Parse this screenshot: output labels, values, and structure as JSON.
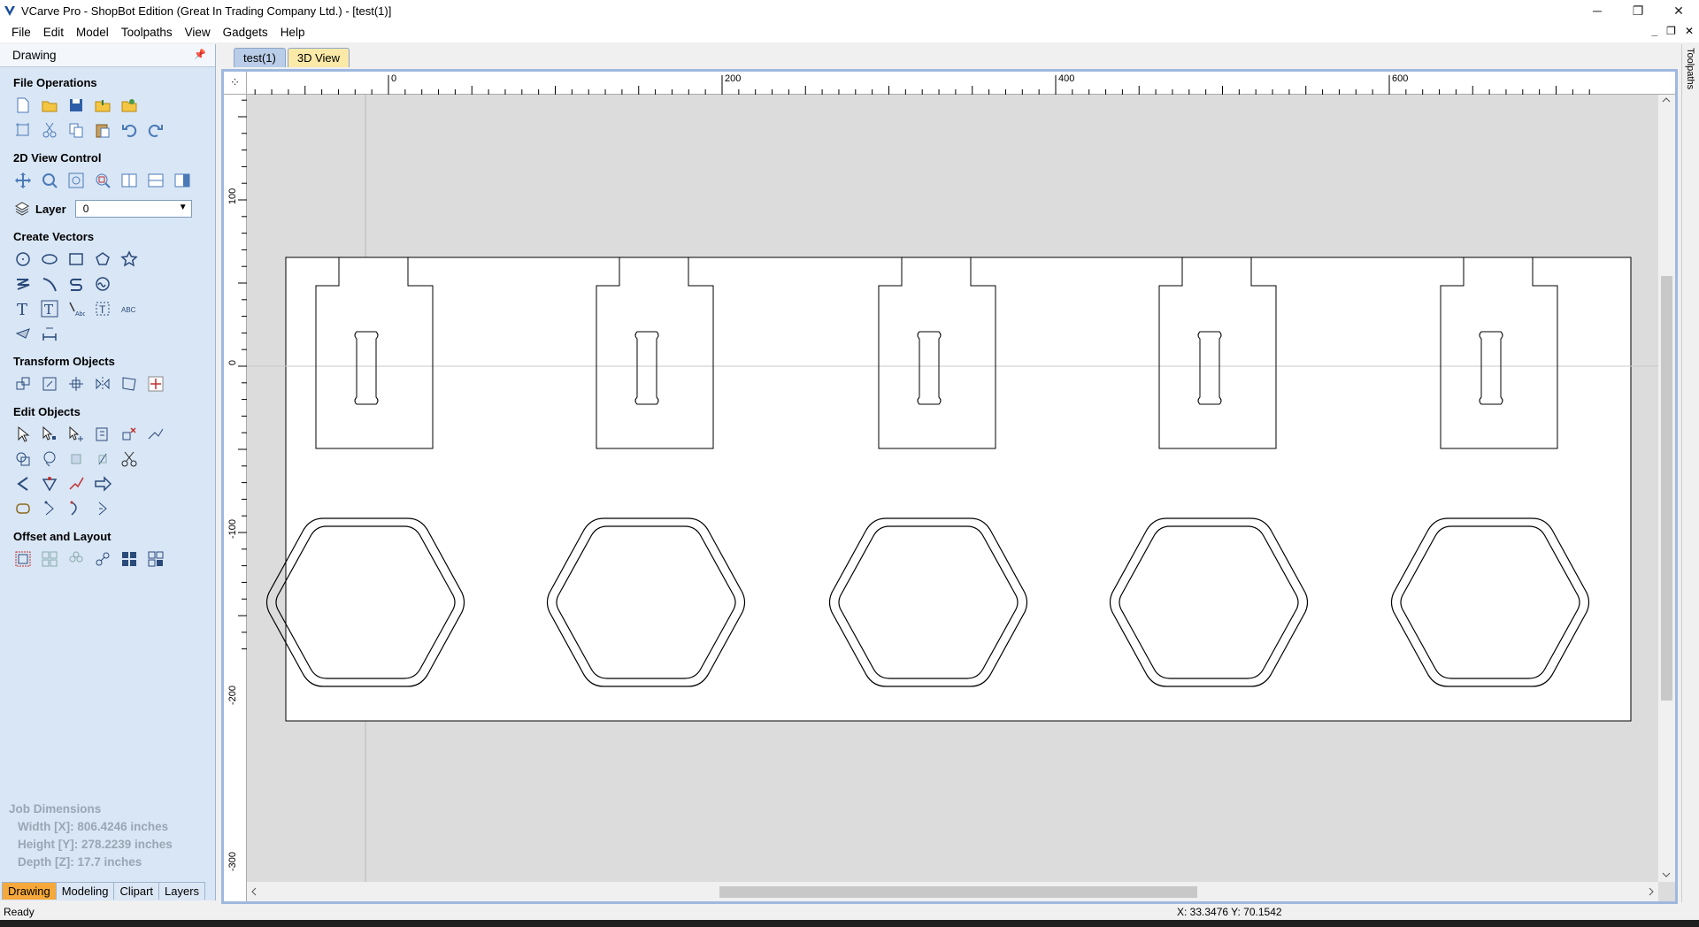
{
  "window": {
    "title": "VCarve Pro - ShopBot Edition (Great In Trading Company Ltd.) - [test(1)]",
    "minimize": "─",
    "restore": "❐",
    "close": "✕",
    "mdi_min": "_",
    "mdi_restore": "❐",
    "mdi_close": "✕"
  },
  "menu": [
    "File",
    "Edit",
    "Model",
    "Toolpaths",
    "View",
    "Gadgets",
    "Help"
  ],
  "panel": {
    "header": "Drawing",
    "sections": {
      "file_ops": "File Operations",
      "view_control": "2D View Control",
      "create_vectors": "Create Vectors",
      "transform": "Transform Objects",
      "edit": "Edit Objects",
      "offset": "Offset and Layout"
    },
    "layer_label": "Layer",
    "layer_value": "0",
    "job_dimensions": {
      "title": "Job Dimensions",
      "width": "Width  [X]: 806.4246 inches",
      "height": "Height [Y]: 278.2239 inches",
      "depth": "Depth  [Z]: 17.7 inches"
    },
    "tabs": [
      "Drawing",
      "Modeling",
      "Clipart",
      "Layers"
    ]
  },
  "doc_tabs": [
    "test(1)",
    "3D View"
  ],
  "right_strip": "Toolpaths",
  "ruler": {
    "top_labels": [
      "0",
      "200",
      "400",
      "600"
    ],
    "left_labels": [
      "100",
      "0",
      "-100",
      "-200",
      "-300"
    ]
  },
  "status": {
    "ready": "Ready",
    "coords": "X: 33.3476 Y: 70.1542"
  },
  "colors": {
    "panel_bg": "#d9e6f5",
    "active_tab": "#f6a83a",
    "canvas_bg": "#dcdcdc",
    "frame": "#9fb8de"
  }
}
